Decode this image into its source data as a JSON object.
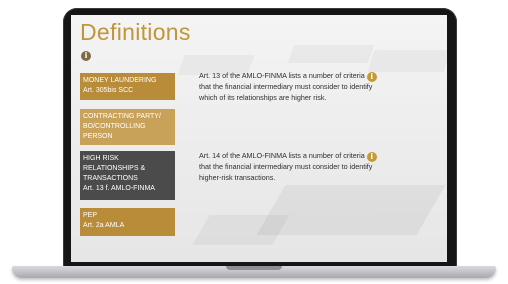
{
  "page": {
    "title": "Definitions",
    "info_icon_glyph": "i"
  },
  "terms": [
    {
      "line1": "MONEY LAUNDERING",
      "line2": "Art. 305bis SCC",
      "line3": "",
      "line4": "",
      "style": "gold"
    },
    {
      "line1": "CONTRACTING PARTY/",
      "line2": "BO/CONTROLLING",
      "line3": "PERSON",
      "line4": "",
      "style": "light"
    },
    {
      "line1": "HIGH RISK",
      "line2": "RELATIONSHIPS &",
      "line3": "TRANSACTIONS",
      "line4": "Art. 13 f. AMLO-FINMA",
      "style": "dark"
    },
    {
      "line1": "PEP",
      "line2": "Art. 2a AMLA",
      "line3": "",
      "line4": "",
      "style": "gold"
    }
  ],
  "descriptions": [
    {
      "line1": "Art. 13 of the AMLO-FINMA lists a number of criteria",
      "line2": "that the financial intermediary must consider to identify",
      "line3": "which of its relationships are higher risk."
    },
    {
      "line1": "Art. 14 of the AMLO-FINMA lists a number of criteria",
      "line2": "that the financial intermediary must consider to identify",
      "line3": "higher-risk transactions."
    }
  ],
  "colors": {
    "gold": "#b88c39",
    "gold_light": "#c9a25a",
    "dark_gray": "#4b4b4b",
    "title_gold": "#c1953a"
  }
}
